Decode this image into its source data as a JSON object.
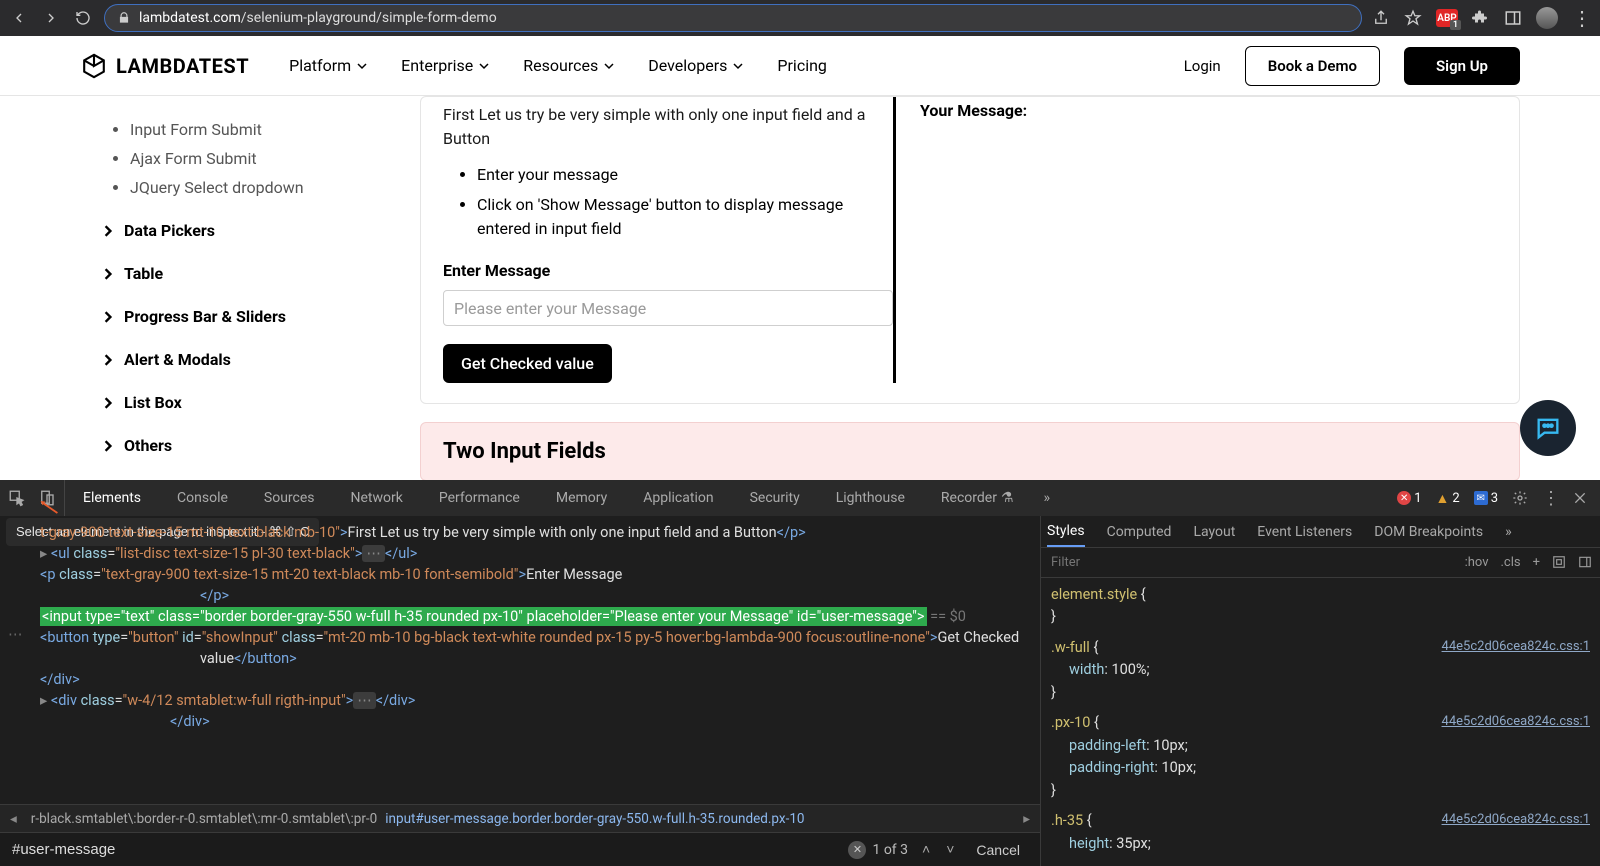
{
  "browser": {
    "url_domain": "lambdatest.com",
    "url_path": "/selenium-playground/simple-form-demo",
    "abp_label": "ABP",
    "abp_badge": "1"
  },
  "header": {
    "logo_text": "LAMBDATEST",
    "nav": [
      "Platform",
      "Enterprise",
      "Resources",
      "Developers",
      "Pricing"
    ],
    "login": "Login",
    "book": "Book a Demo",
    "signup": "Sign Up"
  },
  "sidebar": {
    "items": [
      "Input Form Submit",
      "Ajax Form Submit",
      "JQuery Select dropdown"
    ],
    "groups": [
      "Data Pickers",
      "Table",
      "Progress Bar & Sliders",
      "Alert & Modals",
      "List Box",
      "Others"
    ]
  },
  "form": {
    "intro": "First Let us try be very simple with only one input field and a Button",
    "bullets": [
      "Enter your message",
      "Click on 'Show Message' button to display message entered in input field"
    ],
    "label": "Enter Message",
    "placeholder": "Please enter your Message",
    "button": "Get Checked value",
    "your_message": "Your Message:"
  },
  "panel2_title": "Two Input Fields",
  "devtools": {
    "tabs": [
      "Elements",
      "Console",
      "Sources",
      "Network",
      "Performance",
      "Memory",
      "Application",
      "Security",
      "Lighthouse",
      "Recorder"
    ],
    "tooltip": "Select an element in the page to inspect it - ⌘ ⇧ C",
    "counts": {
      "err": "1",
      "warn": "2",
      "info": "3"
    },
    "styles_tabs": [
      "Styles",
      "Computed",
      "Layout",
      "Event Listeners",
      "DOM Breakpoints"
    ],
    "styles_filter": "Filter",
    "styles_btns": [
      ":hov",
      ".cls",
      "+"
    ],
    "rules": [
      {
        "selector": "element.style",
        "src": "",
        "props": []
      },
      {
        "selector": ".w-full",
        "src": "44e5c2d06cea824c.css:1",
        "props": [
          {
            "n": "width",
            "v": "100%;"
          }
        ]
      },
      {
        "selector": ".px-10",
        "src": "44e5c2d06cea824c.css:1",
        "props": [
          {
            "n": "padding-left",
            "v": "10px;"
          },
          {
            "n": "padding-right",
            "v": "10px;"
          }
        ]
      },
      {
        "selector": ".h-35",
        "src": "44e5c2d06cea824c.css:1",
        "props": [
          {
            "n": "height",
            "v": "35px;"
          }
        ]
      }
    ],
    "crumbs": [
      "r-black.smtablet\\:border-r-0.smtablet\\:mr-0.smtablet\\:pr-0",
      "input#user-message.border.border-gray-550.w-full.h-35.rounded.px-10"
    ],
    "find_value": "#user-message",
    "find_count": "1 of 3",
    "cancel": "Cancel",
    "dom_p_text": "First Let us try be very simple with only one input field and a Button",
    "dom_label": "Enter Message",
    "dom_button": "Get Checked value",
    "dom_input": "<input type=\"text\" class=\"border border-gray-550 w-full h-35 rounded px-10\" placeholder=\"Please enter your Message\" id=\"user-message\">",
    "eq0": " == $0"
  }
}
